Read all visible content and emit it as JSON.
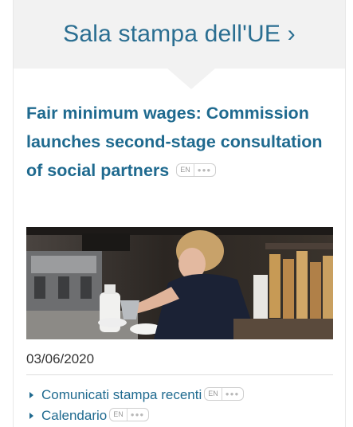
{
  "header": {
    "title": "Sala stampa dell'UE ›"
  },
  "article": {
    "headline": "Fair minimum wages: Commission launches second-stage consultation of social partners",
    "lang_code": "EN",
    "lang_more": "●●●",
    "image_alt": "Barista pouring milk into a cup at a coffee machine",
    "date": "03/06/2020"
  },
  "links": [
    {
      "label": "Comunicati stampa recenti",
      "lang_code": "EN",
      "lang_more": "●●●"
    },
    {
      "label": "Calendario",
      "lang_code": "EN",
      "lang_more": "●●●"
    }
  ],
  "colors": {
    "link": "#1f6a8f",
    "header_bg": "#f2f2f2",
    "text": "#333333"
  }
}
